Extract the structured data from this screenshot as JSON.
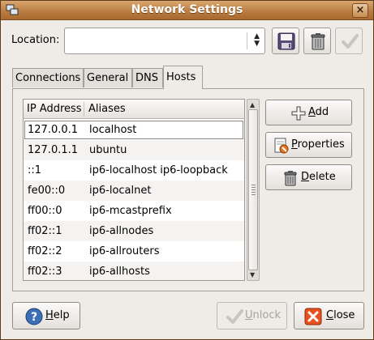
{
  "window": {
    "title": "Network Settings",
    "close_glyph": "×"
  },
  "toolbar": {
    "location_label": "Location:",
    "location_value": "",
    "icons": [
      "floppy-save-icon",
      "trash-delete-icon",
      "checkmark-apply-icon"
    ]
  },
  "tabs": [
    {
      "label": "Connections",
      "active": false
    },
    {
      "label": "General",
      "active": false
    },
    {
      "label": "DNS",
      "active": false
    },
    {
      "label": "Hosts",
      "active": true
    }
  ],
  "hosts": {
    "columns": [
      "IP Address",
      "Aliases"
    ],
    "rows": [
      {
        "ip": "127.0.0.1",
        "alias": "localhost"
      },
      {
        "ip": "127.0.1.1",
        "alias": "ubuntu"
      },
      {
        "ip": "::1",
        "alias": "ip6-localhost ip6-loopback"
      },
      {
        "ip": "fe00::0",
        "alias": "ip6-localnet"
      },
      {
        "ip": "ff00::0",
        "alias": "ip6-mcastprefix"
      },
      {
        "ip": "ff02::1",
        "alias": "ip6-allnodes"
      },
      {
        "ip": "ff02::2",
        "alias": "ip6-allrouters"
      },
      {
        "ip": "ff02::3",
        "alias": "ip6-allhosts"
      }
    ]
  },
  "side_buttons": {
    "add": {
      "mnemonic": "A",
      "rest": "dd"
    },
    "properties": {
      "mnemonic": "P",
      "rest": "roperties"
    },
    "delete": {
      "mnemonic": "D",
      "rest": "elete"
    }
  },
  "bottom_buttons": {
    "help": {
      "mnemonic": "H",
      "rest": "elp"
    },
    "unlock": {
      "mnemonic": "U",
      "rest": "nlock"
    },
    "close": {
      "mnemonic": "C",
      "rest": "lose"
    }
  },
  "colors": {
    "titlebar": "#b97a40",
    "window_bg": "#efebe7",
    "close_icon_red": "#e8501e"
  }
}
